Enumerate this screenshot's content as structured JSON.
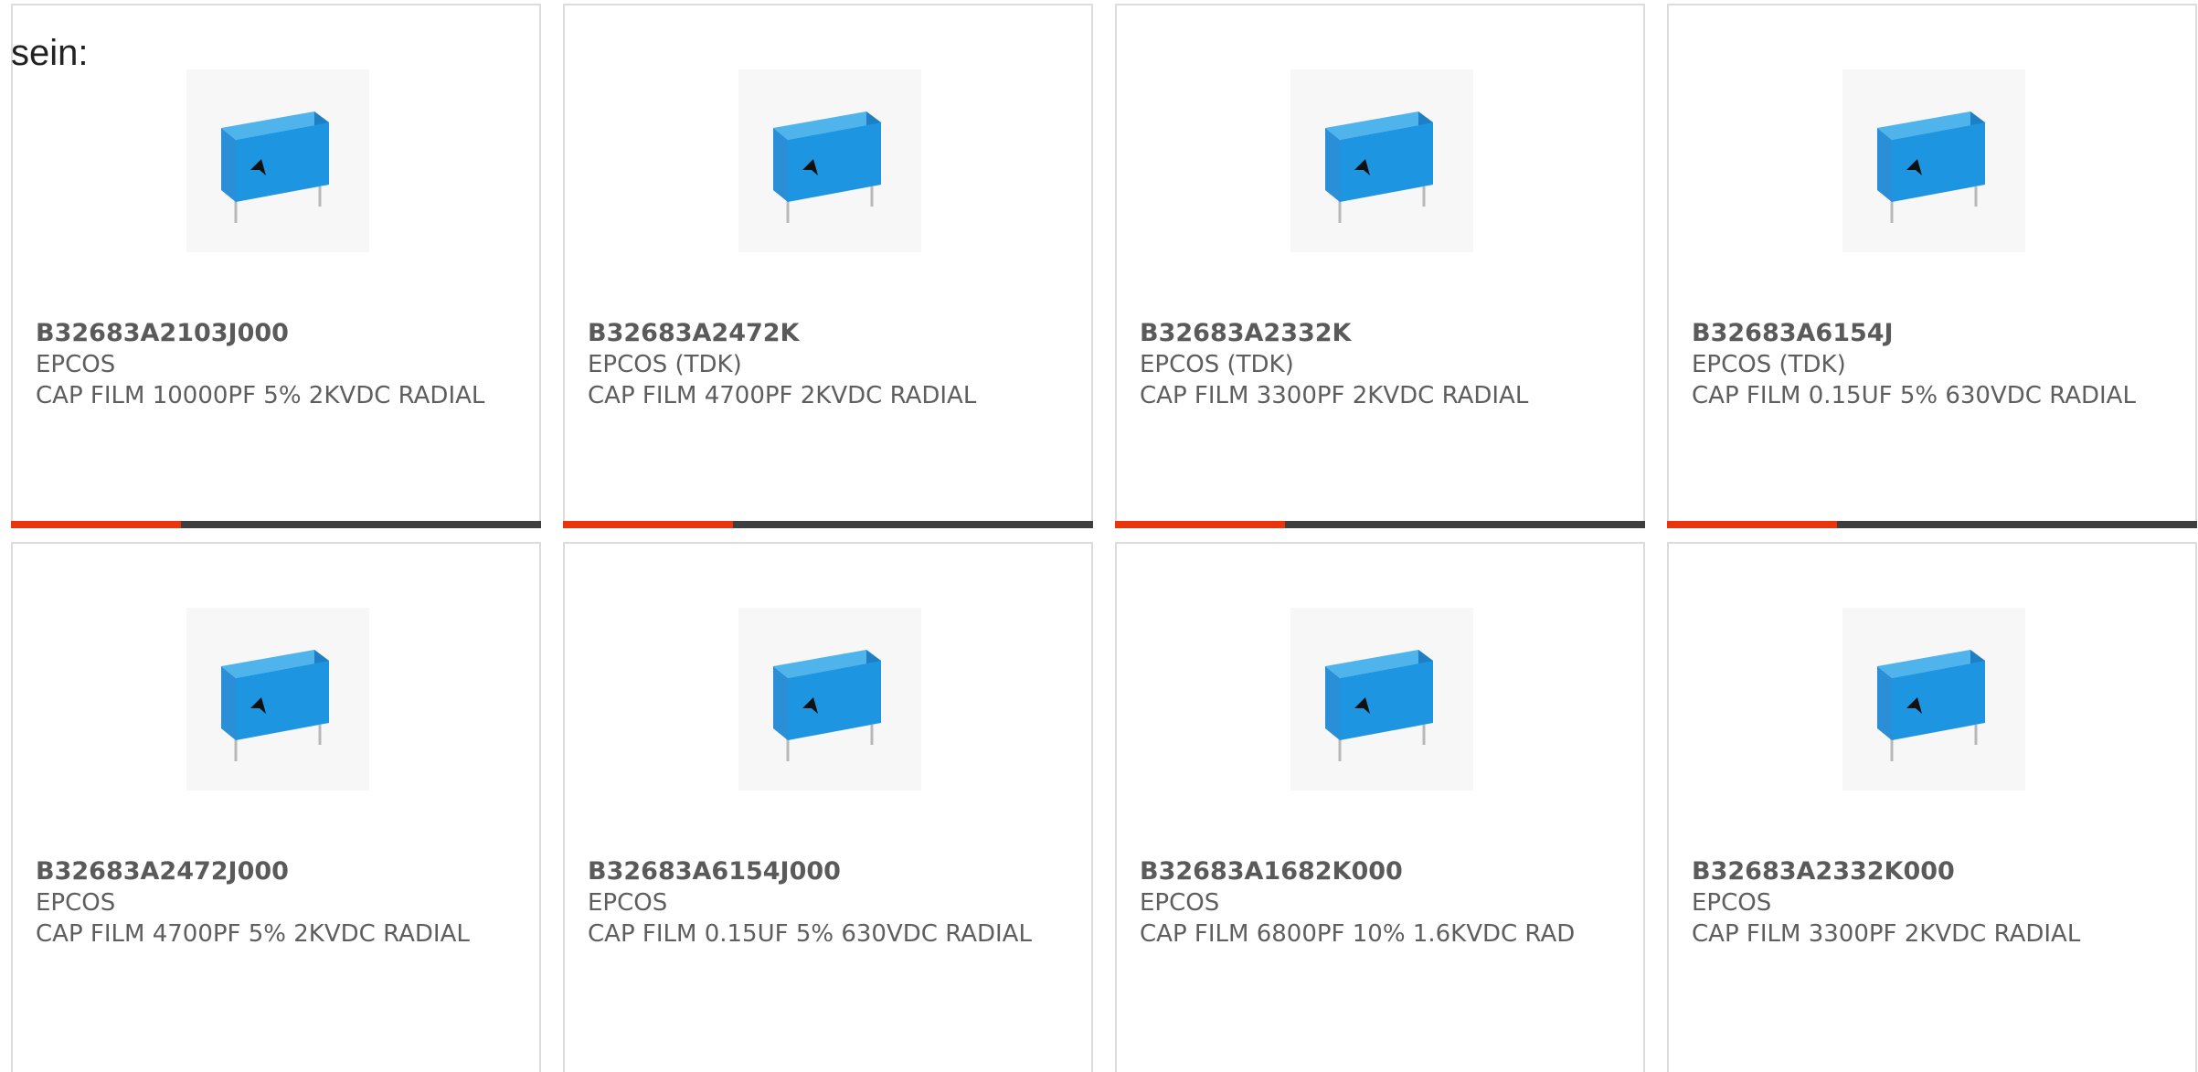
{
  "intro_text": "sein:",
  "accent_color": "#e8350e",
  "track_color": "#3e3e3e",
  "products": [
    {
      "part": "B32683A2103J000",
      "manufacturer": "EPCOS",
      "description": "CAP FILM 10000PF 5% 2KVDC RADIAL",
      "icon": "film-capacitor-icon",
      "progress": 0.32
    },
    {
      "part": "B32683A2472K",
      "manufacturer": "EPCOS (TDK)",
      "description": "CAP FILM 4700PF 2KVDC RADIAL",
      "icon": "film-capacitor-icon",
      "progress": 0.32
    },
    {
      "part": "B32683A2332K",
      "manufacturer": "EPCOS (TDK)",
      "description": "CAP FILM 3300PF 2KVDC RADIAL",
      "icon": "film-capacitor-icon",
      "progress": 0.32
    },
    {
      "part": "B32683A6154J",
      "manufacturer": "EPCOS (TDK)",
      "description": "CAP FILM 0.15UF 5% 630VDC RADIAL",
      "icon": "film-capacitor-icon",
      "progress": 0.32
    },
    {
      "part": "B32683A2472J000",
      "manufacturer": "EPCOS",
      "description": "CAP FILM 4700PF 5% 2KVDC RADIAL",
      "icon": "film-capacitor-icon"
    },
    {
      "part": "B32683A6154J000",
      "manufacturer": "EPCOS",
      "description": "CAP FILM 0.15UF 5% 630VDC RADIAL",
      "icon": "film-capacitor-icon"
    },
    {
      "part": "B32683A1682K000",
      "manufacturer": "EPCOS",
      "description": "CAP FILM 6800PF 10% 1.6KVDC RAD",
      "icon": "film-capacitor-icon"
    },
    {
      "part": "B32683A2332K000",
      "manufacturer": "EPCOS",
      "description": "CAP FILM 3300PF 2KVDC RADIAL",
      "icon": "film-capacitor-icon"
    }
  ]
}
